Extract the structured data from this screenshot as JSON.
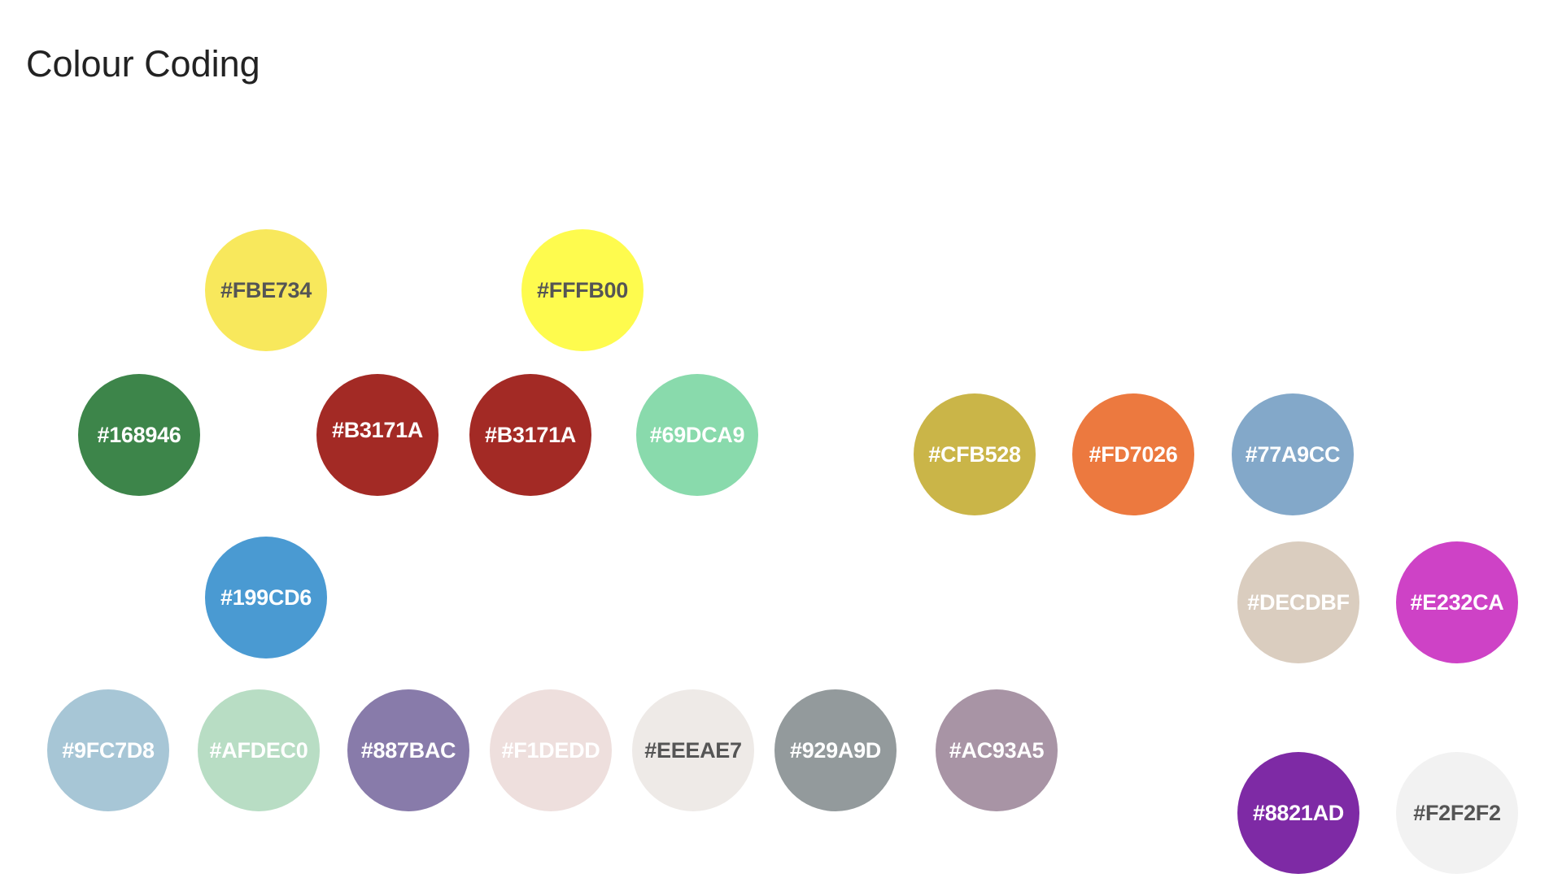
{
  "page": {
    "title": "Colour Coding"
  },
  "swatches": [
    {
      "label": "#FBE734",
      "color": "#F8E85C",
      "text": "dark"
    },
    {
      "label": "#FFFB00",
      "color": "#FEFB4E",
      "text": "dark"
    },
    {
      "label": "#168946",
      "color": "#3D854A",
      "text": "light"
    },
    {
      "label": "#B3171A",
      "color": "#A32A25",
      "text": "light"
    },
    {
      "label": "#B3171A",
      "color": "#A32A25",
      "text": "light"
    },
    {
      "label": "#69DCA9",
      "color": "#89DAAC",
      "text": "light"
    },
    {
      "label": "#CFB528",
      "color": "#CAB548",
      "text": "light"
    },
    {
      "label": "#FD7026",
      "color": "#EC793F",
      "text": "light"
    },
    {
      "label": "#77A9CC",
      "color": "#83A8C9",
      "text": "light"
    },
    {
      "label": "#199CD6",
      "color": "#4A9AD2",
      "text": "light"
    },
    {
      "label": "#DECDBF",
      "color": "#DACDBF",
      "text": "light"
    },
    {
      "label": "#E232CA",
      "color": "#CE42C6",
      "text": "light"
    },
    {
      "label": "#9FC7D8",
      "color": "#A7C6D6",
      "text": "light"
    },
    {
      "label": "#AFDEC0",
      "color": "#B8DDC4",
      "text": "light"
    },
    {
      "label": "#887BAC",
      "color": "#887BAA",
      "text": "light"
    },
    {
      "label": "#F1DEDD",
      "color": "#EEDFDD",
      "text": "light"
    },
    {
      "label": "#EEEAE7",
      "color": "#EEEAE7",
      "text": "dark"
    },
    {
      "label": "#929A9D",
      "color": "#939A9C",
      "text": "light"
    },
    {
      "label": "#AC93A5",
      "color": "#A894A5",
      "text": "light"
    },
    {
      "label": "#8821AD",
      "color": "#7E2AA5",
      "text": "light"
    },
    {
      "label": "#F2F2F2",
      "color": "#F2F2F2",
      "text": "dark"
    }
  ]
}
